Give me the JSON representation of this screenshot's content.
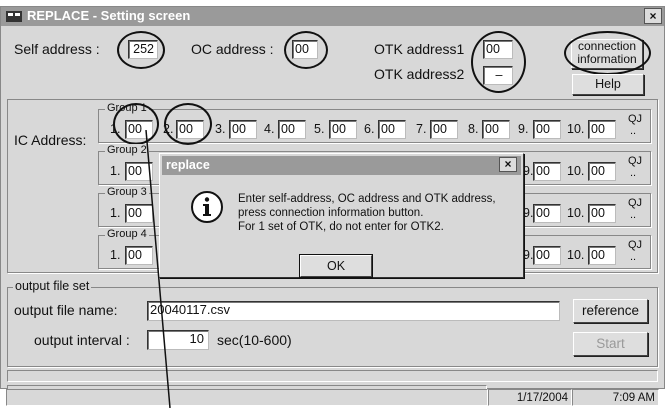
{
  "window": {
    "title": "REPLACE - Setting screen",
    "close_glyph": "×"
  },
  "header": {
    "self_address_label": "Self address :",
    "self_address_value": "252",
    "oc_address_label": "OC address :",
    "oc_address_value": "00",
    "otk1_label": "OTK address1",
    "otk1_value": "00",
    "otk2_label": "OTK address2",
    "otk2_value": "–",
    "connection_info_label_1": "connection",
    "connection_info_label_2": "information",
    "help_label": "Help"
  },
  "ic": {
    "label": "IC Address:",
    "suffix_1": "QJ",
    "suffix_2": "..",
    "groups": [
      {
        "caption": "Group 1",
        "nums": [
          "1.",
          "2.",
          "3.",
          "4.",
          "5.",
          "6.",
          "7.",
          "8.",
          "9.",
          "10."
        ],
        "values": [
          "00",
          "00",
          "00",
          "00",
          "00",
          "00",
          "00",
          "00",
          "00",
          "00"
        ]
      },
      {
        "caption": "Group 2",
        "nums": [
          "1.",
          "9.",
          "10."
        ],
        "values": [
          "00",
          "00",
          "00"
        ]
      },
      {
        "caption": "Group 3",
        "nums": [
          "1.",
          "9.",
          "10."
        ],
        "values": [
          "00",
          "00",
          "00"
        ]
      },
      {
        "caption": "Group 4",
        "nums": [
          "1.",
          "9.",
          "10."
        ],
        "values": [
          "00",
          "00",
          "00"
        ]
      }
    ]
  },
  "output": {
    "caption": "output file set",
    "file_label": "output file name:",
    "file_value": "20040117.csv",
    "interval_label": "output interval :",
    "interval_value": "10",
    "interval_unit": "sec(10-600)",
    "reference_label": "reference",
    "start_label": "Start"
  },
  "status": {
    "date": "1/17/2004",
    "time": "7:09 AM"
  },
  "dialog": {
    "title": "replace",
    "close_glyph": "×",
    "icon": "info-icon",
    "line1": "Enter self-address, OC address and OTK address,",
    "line2": "press connection information button.",
    "line3": "For 1 set of OTK, do not enter for OTK2.",
    "ok_label": "OK"
  },
  "colors": {
    "window_bg": "#d8d8d8",
    "titlebar": "#9a9a9a",
    "field_bg": "#ffffff"
  }
}
